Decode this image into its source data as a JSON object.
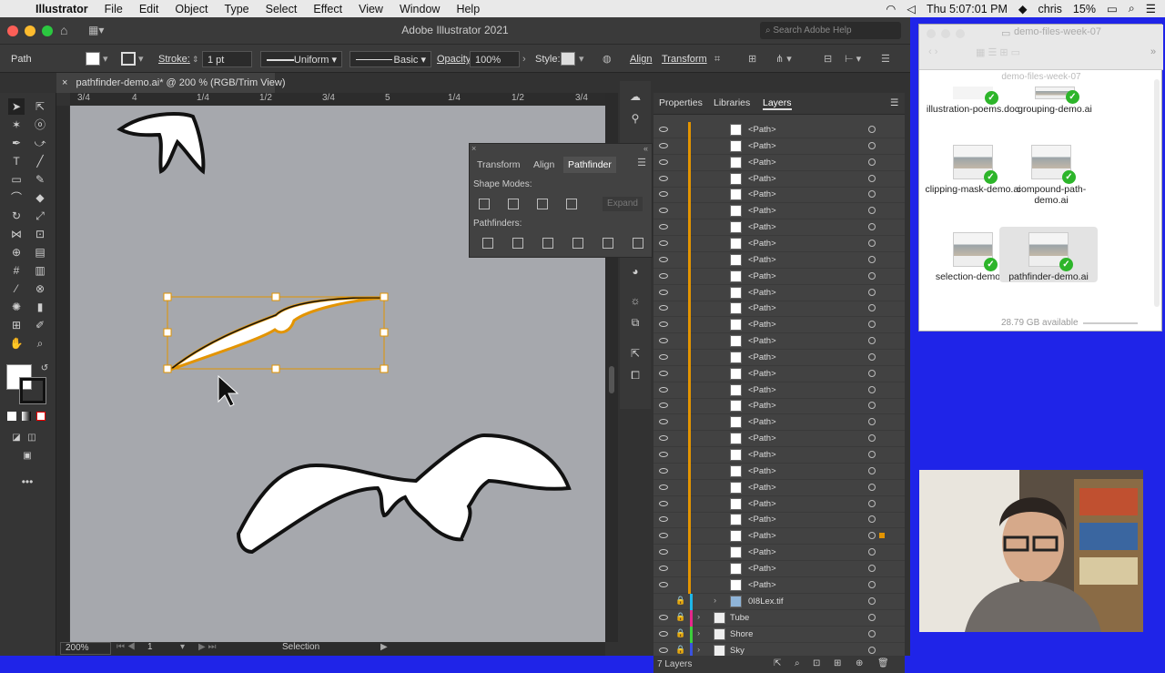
{
  "menubar": {
    "app_name": "Illustrator",
    "items": [
      "File",
      "Edit",
      "Object",
      "Type",
      "Select",
      "Effect",
      "View",
      "Window",
      "Help"
    ],
    "clock": "Thu 5:07:01 PM",
    "user": "chris",
    "battery": "15%"
  },
  "window": {
    "title": "Adobe Illustrator 2021",
    "search_placeholder": "Search Adobe Help"
  },
  "controlbar": {
    "selection_label": "Path",
    "stroke_label": "Stroke:",
    "stroke_value": "1 pt",
    "profile": "Uniform",
    "brush": "Basic",
    "opacity_label": "Opacity:",
    "opacity_value": "100%",
    "style_label": "Style:",
    "align": "Align",
    "transform": "Transform"
  },
  "document": {
    "tab_title": "pathfinder-demo.ai* @ 200 % (RGB/Trim View)",
    "ruler_labels": [
      "3/4",
      "4",
      "1/4",
      "1/2",
      "3/4",
      "5",
      "1/4",
      "1/2",
      "3/4"
    ],
    "zoom": "200%",
    "artboard": "1",
    "status": "Selection"
  },
  "pathfinder_panel": {
    "tabs": [
      "Transform",
      "Align",
      "Pathfinder"
    ],
    "active_tab": "Pathfinder",
    "shape_modes_label": "Shape Modes:",
    "expand_label": "Expand",
    "pathfinders_label": "Pathfinders:"
  },
  "layers_panel": {
    "tabs": [
      "Properties",
      "Libraries",
      "Layers"
    ],
    "active_tab": "Layers",
    "path_rows": [
      "<Path>",
      "<Path>",
      "<Path>",
      "<Path>",
      "<Path>",
      "<Path>",
      "<Path>",
      "<Path>",
      "<Path>",
      "<Path>",
      "<Path>",
      "<Path>",
      "<Path>",
      "<Path>",
      "<Path>",
      "<Path>",
      "<Path>",
      "<Path>",
      "<Path>",
      "<Path>",
      "<Path>",
      "<Path>",
      "<Path>",
      "<Path>",
      "<Path>",
      "<Path>",
      "<Path>",
      "<Path>",
      "<Path>"
    ],
    "layers": [
      {
        "name": "0I8Lex.tif",
        "color": "#1fb6e8"
      },
      {
        "name": "Tube",
        "color": "#e6278c"
      },
      {
        "name": "Shore",
        "color": "#3ccf3c"
      },
      {
        "name": "Sky",
        "color": "#3a52e0"
      }
    ],
    "footer": "7 Layers"
  },
  "finder": {
    "title": "demo-files-week-07",
    "path": "demo-files-week-07",
    "files": [
      {
        "name": "illustration-poems.doc"
      },
      {
        "name": "grouping-demo.ai"
      },
      {
        "name": "clipping-mask-demo.ai"
      },
      {
        "name": "compound-path-demo.ai"
      },
      {
        "name": "selection-demo.ai"
      },
      {
        "name": "pathfinder-demo.ai"
      }
    ],
    "footer": "28.79 GB available"
  },
  "colors": {
    "accent": "#e39400",
    "selection": "#f0a030",
    "desktop": "#1f24e8"
  }
}
